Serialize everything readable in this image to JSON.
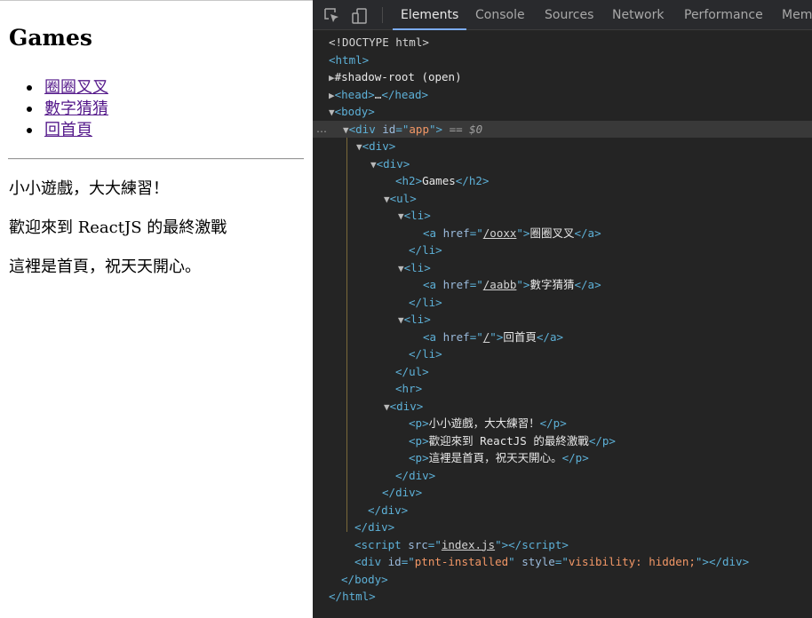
{
  "page": {
    "heading": "Games",
    "links": [
      "圈圈叉叉",
      "數字猜猜",
      "回首頁"
    ],
    "paragraphs": [
      "小小遊戲，大大練習！",
      "歡迎來到 ReactJS 的最終激戰",
      "這裡是首頁，祝天天開心。"
    ]
  },
  "devtools": {
    "tabs": [
      "Elements",
      "Console",
      "Sources",
      "Network",
      "Performance",
      "Mem"
    ],
    "active_tab": "Elements",
    "icons": [
      "inspect-element-icon",
      "device-toolbar-icon"
    ],
    "dom": {
      "doctype": "<!DOCTYPE html>",
      "html": "html",
      "shadow_root": "#shadow-root (open)",
      "head": "head",
      "body": "body",
      "div": "div",
      "h2": "h2",
      "ul": "ul",
      "li": "li",
      "a": "a",
      "hr": "hr",
      "p": "p",
      "script": "script",
      "attr_id": "id",
      "attr_href": "href",
      "attr_src": "src",
      "attr_style": "style",
      "app_id": "app",
      "selected_marker": "== $0",
      "href_ooxx": "/ooxx",
      "href_aabb": "/aabb",
      "href_root": "/",
      "script_src": "index.js",
      "ptnt_id": "ptnt-installed",
      "ptnt_style": "visibility: hidden;",
      "ellipsis": "…",
      "row_dots": "…"
    }
  }
}
